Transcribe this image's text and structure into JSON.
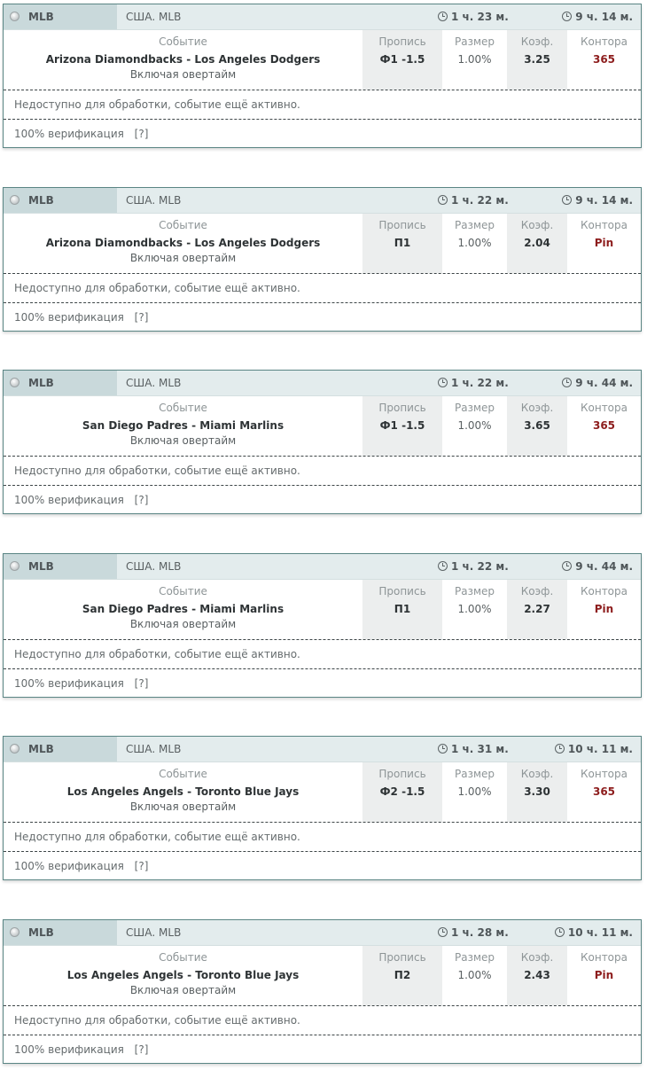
{
  "columns": {
    "event": "Событие",
    "line": "Пропись",
    "size": "Размер",
    "odds": "Коэф.",
    "bookmaker": "Контора"
  },
  "cards": [
    {
      "league": "MLB",
      "region": "США. MLB",
      "timer1": "1 ч. 23 м.",
      "timer2": "9 ч. 14 м.",
      "event": "Arizona Diamondbacks - Los Angeles Dodgers",
      "overtime": "Включая овертайм",
      "line": "Ф1 -1.5",
      "size": "1.00%",
      "odds": "3.25",
      "bookmaker": "365",
      "status": "Недоступно для обработки, событие ещё активно.",
      "verification": "100% верификация",
      "help": "[?]"
    },
    {
      "league": "MLB",
      "region": "США. MLB",
      "timer1": "1 ч. 22 м.",
      "timer2": "9 ч. 14 м.",
      "event": "Arizona Diamondbacks - Los Angeles Dodgers",
      "overtime": "Включая овертайм",
      "line": "П1",
      "size": "1.00%",
      "odds": "2.04",
      "bookmaker": "Pin",
      "status": "Недоступно для обработки, событие ещё активно.",
      "verification": "100% верификация",
      "help": "[?]"
    },
    {
      "league": "MLB",
      "region": "США. MLB",
      "timer1": "1 ч. 22 м.",
      "timer2": "9 ч. 44 м.",
      "event": "San Diego Padres - Miami Marlins",
      "overtime": "Включая овертайм",
      "line": "Ф1 -1.5",
      "size": "1.00%",
      "odds": "3.65",
      "bookmaker": "365",
      "status": "Недоступно для обработки, событие ещё активно.",
      "verification": "100% верификация",
      "help": "[?]"
    },
    {
      "league": "MLB",
      "region": "США. MLB",
      "timer1": "1 ч. 22 м.",
      "timer2": "9 ч. 44 м.",
      "event": "San Diego Padres - Miami Marlins",
      "overtime": "Включая овертайм",
      "line": "П1",
      "size": "1.00%",
      "odds": "2.27",
      "bookmaker": "Pin",
      "status": "Недоступно для обработки, событие ещё активно.",
      "verification": "100% верификация",
      "help": "[?]"
    },
    {
      "league": "MLB",
      "region": "США. MLB",
      "timer1": "1 ч. 31 м.",
      "timer2": "10 ч. 11 м.",
      "event": "Los Angeles Angels - Toronto Blue Jays",
      "overtime": "Включая овертайм",
      "line": "Ф2 -1.5",
      "size": "1.00%",
      "odds": "3.30",
      "bookmaker": "365",
      "status": "Недоступно для обработки, событие ещё активно.",
      "verification": "100% верификация",
      "help": "[?]"
    },
    {
      "league": "MLB",
      "region": "США. MLB",
      "timer1": "1 ч. 28 м.",
      "timer2": "10 ч. 11 м.",
      "event": "Los Angeles Angels - Toronto Blue Jays",
      "overtime": "Включая овертайм",
      "line": "П2",
      "size": "1.00%",
      "odds": "2.43",
      "bookmaker": "Pin",
      "status": "Недоступно для обработки, событие ещё активно.",
      "verification": "100% верификация",
      "help": "[?]"
    }
  ]
}
